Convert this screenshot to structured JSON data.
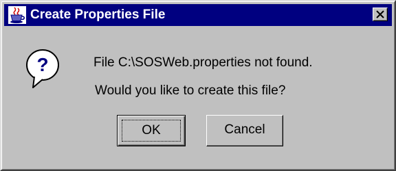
{
  "window": {
    "title": "Create Properties File",
    "app_icon": "java-cup-icon",
    "close_icon": "close-icon"
  },
  "message": {
    "icon": "question-icon",
    "line1": "File C:\\SOSWeb.properties not found.",
    "line2": "Would you like to create this file?"
  },
  "buttons": {
    "ok_label": "OK",
    "cancel_label": "Cancel"
  },
  "colors": {
    "title_bar": "#000080",
    "face": "#c0c0c0",
    "question_mark": "#000080"
  }
}
